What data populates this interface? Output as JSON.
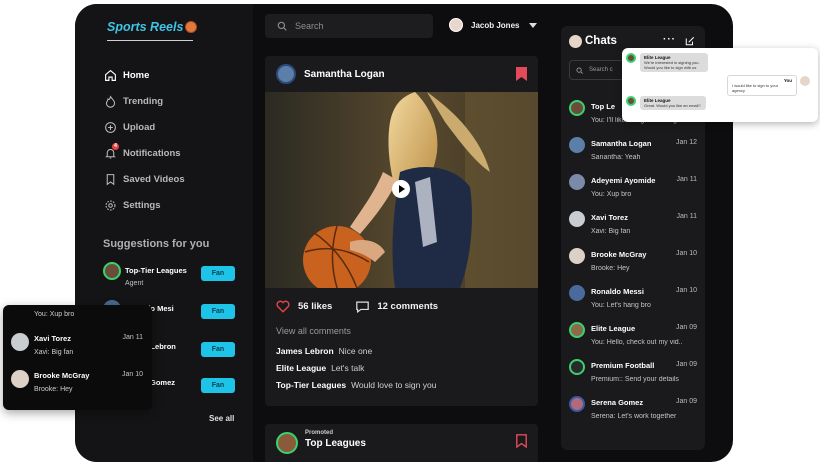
{
  "app": {
    "brand": "Sports Reels"
  },
  "sidebar": {
    "nav": [
      {
        "label": "Home",
        "icon": "home-icon",
        "active": true
      },
      {
        "label": "Trending",
        "icon": "flame-icon",
        "active": false
      },
      {
        "label": "Upload",
        "icon": "upload-icon",
        "active": false
      },
      {
        "label": "Notifications",
        "icon": "bell-icon",
        "active": false,
        "badge": "4"
      },
      {
        "label": "Saved Videos",
        "icon": "bookmark-icon",
        "active": false
      },
      {
        "label": "Settings",
        "icon": "gear-icon",
        "active": false
      }
    ],
    "suggestions_title": "Suggestions for you",
    "suggestions": [
      {
        "name": "Top-Tier Leagues",
        "sub": "Agent",
        "button": "Fan"
      },
      {
        "name": "Ronaldo Mesi",
        "sub": "",
        "button": "Fan"
      },
      {
        "name": "James Lebron",
        "sub": "",
        "button": "Fan"
      },
      {
        "name": "Sirena Gomez",
        "sub": "",
        "button": "Fan"
      }
    ],
    "see_all": "See all"
  },
  "header": {
    "search_placeholder": "Search",
    "user_name": "Jacob Jones"
  },
  "post": {
    "author": "Samantha Logan",
    "likes": "56 likes",
    "comments_count": "12 comments",
    "view_all": "View all comments",
    "comments": [
      {
        "author": "James Lebron",
        "text": "Nice one"
      },
      {
        "author": "Elite League",
        "text": "Let's talk"
      },
      {
        "author": "Top-Tier Leagues",
        "text": "Would love to sign you"
      }
    ]
  },
  "promoted": {
    "label": "Promoted",
    "name": "Top Leagues"
  },
  "chats": {
    "title": "Chats",
    "search_placeholder": "Search c",
    "items": [
      {
        "name": "Top Le",
        "date": "",
        "msg": "You: I'll like to sign to our lig"
      },
      {
        "name": "Samantha Logan",
        "date": "Jan 12",
        "msg": "Sanantha: Yeah"
      },
      {
        "name": "Adeyemi Ayomide",
        "date": "Jan 11",
        "msg": "You: Xup bro"
      },
      {
        "name": "Xavi Torez",
        "date": "Jan 11",
        "msg": "Xavi: Big fan"
      },
      {
        "name": "Brooke McGray",
        "date": "Jan 10",
        "msg": "Brooke: Hey"
      },
      {
        "name": "Ronaldo Messi",
        "date": "Jan 10",
        "msg": "You: Let's hang bro"
      },
      {
        "name": "Elite League",
        "date": "Jan 09",
        "msg": "You: Hello, check out my vid.."
      },
      {
        "name": "Premium Football",
        "date": "Jan 09",
        "msg": "Premium:: Send your details"
      },
      {
        "name": "Serena Gomez",
        "date": "Jan 09",
        "msg": "Serena: Let's work together"
      }
    ]
  },
  "overlay_left": {
    "top_msg": "You: Xup bro",
    "items": [
      {
        "name": "Xavi Torez",
        "date": "Jan 11",
        "msg": "Xavi: Big fan"
      },
      {
        "name": "Brooke McGray",
        "date": "Jan 10",
        "msg": "Brooke: Hey"
      }
    ]
  },
  "overlay_right": {
    "bubble1_name": "Elite League",
    "bubble1_text": "We're interested in signing you. Would you like to sign with us",
    "reply_label": "You",
    "reply_text": "I would like to sign to your agency",
    "bubble2_name": "Elite League",
    "bubble2_text": "Great. Would you like an email?"
  },
  "colors": {
    "accent": "#1ec4e8",
    "brand": "#3ec4e6",
    "like": "#e34444",
    "bookmark": "#e34a5a"
  }
}
